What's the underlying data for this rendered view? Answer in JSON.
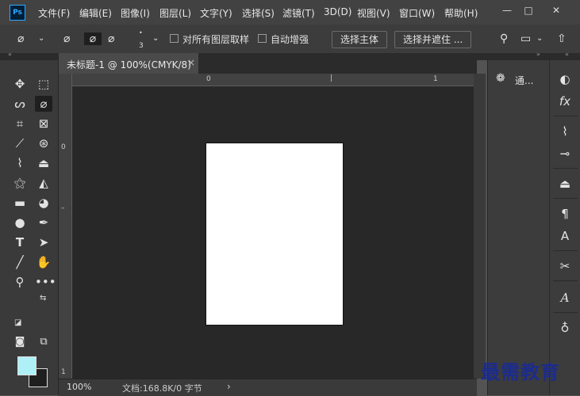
{
  "app": {
    "logo_text": "Ps"
  },
  "menu": [
    "文件(F)",
    "编辑(E)",
    "图像(I)",
    "图层(L)",
    "文字(Y)",
    "选择(S)",
    "滤镜(T)",
    "3D(D)",
    "视图(V)",
    "窗口(W)",
    "帮助(H)"
  ],
  "window_controls": {
    "minimize": "—",
    "restore": "□",
    "close": "✕"
  },
  "options": {
    "brush_size": "3",
    "sample_all_layers": "对所有图层取样",
    "sample_all_checked": false,
    "auto_enhance": "自动增强",
    "auto_enhance_checked": false,
    "select_subject": "选择主体",
    "select_and_mask": "选择并遮住 ..."
  },
  "document": {
    "tab_title": "未标题-1 @ 100%(CMYK/8)",
    "tab_close": "×",
    "zoom": "100%",
    "doc_info": "文档:168.8K/0 字节",
    "status_arrow": "›"
  },
  "rulers": {
    "h_zero": "0",
    "h_one": "1",
    "v_zero": "0",
    "v_one": "1"
  },
  "colors": {
    "foreground": "#aef0f6",
    "background": "#1f1f1f",
    "accent": "#31a8ff"
  },
  "panels": {
    "channels_label": "通..."
  },
  "watermark": "最需教育"
}
